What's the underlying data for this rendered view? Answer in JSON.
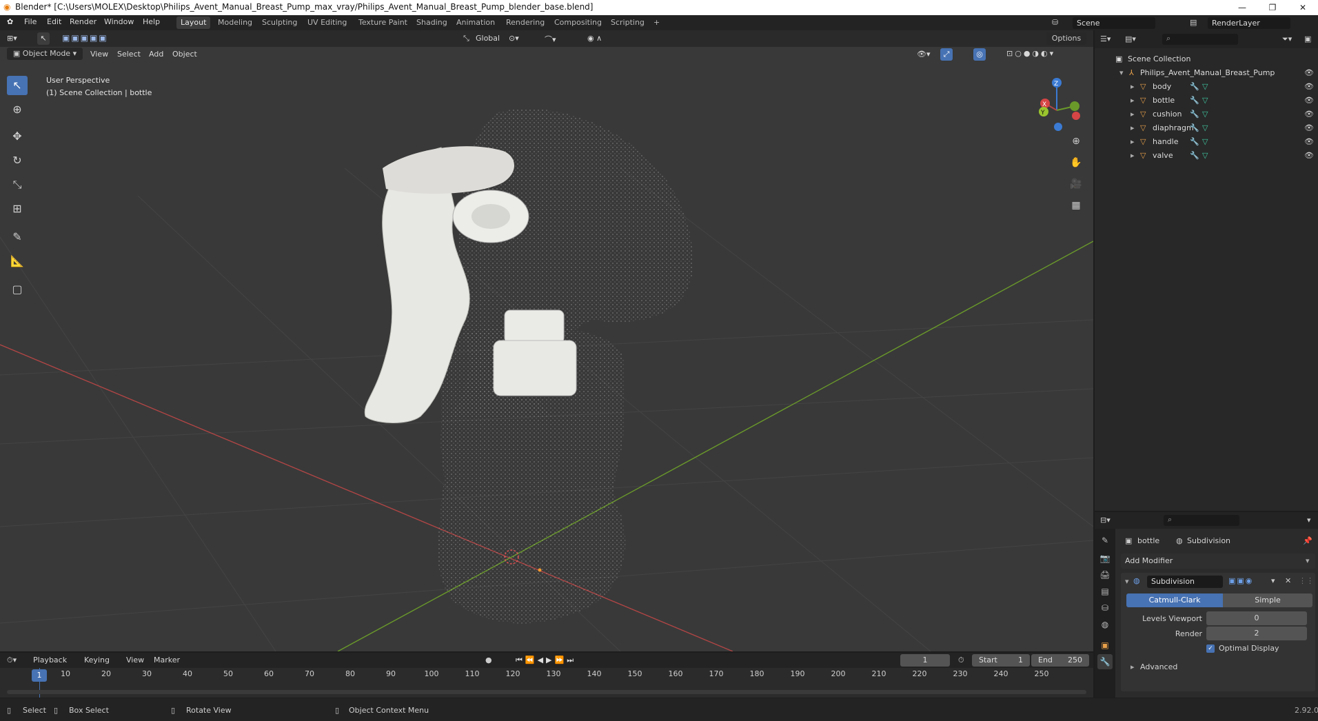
{
  "window": {
    "title": "Blender* [C:\\Users\\MOLEX\\Desktop\\Philips_Avent_Manual_Breast_Pump_max_vray/Philips_Avent_Manual_Breast_Pump_blender_base.blend]",
    "minimize": "—",
    "maximize": "❐",
    "close": "✕"
  },
  "menu": {
    "file": "File",
    "edit": "Edit",
    "render": "Render",
    "window": "Window",
    "help": "Help"
  },
  "workspaces": [
    "Layout",
    "Modeling",
    "Sculpting",
    "UV Editing",
    "Texture Paint",
    "Shading",
    "Animation",
    "Rendering",
    "Compositing",
    "Scripting"
  ],
  "scene": {
    "name": "Scene",
    "render_layer": "RenderLayer"
  },
  "viewport": {
    "mode": "Object Mode",
    "menu": {
      "view": "View",
      "select": "Select",
      "add": "Add",
      "object": "Object"
    },
    "transform_orientation": "Global",
    "options": "Options",
    "overlay_text_1": "User Perspective",
    "overlay_text_2": "(1) Scene Collection | bottle",
    "gizmo": {
      "z": "Z",
      "y": "Y",
      "x": "X"
    }
  },
  "outliner": {
    "root": "Scene Collection",
    "collection": "Philips_Avent_Manual_Breast_Pump",
    "objects": [
      "body",
      "bottle",
      "cushion",
      "diaphragm",
      "handle",
      "valve"
    ]
  },
  "properties": {
    "object": "bottle",
    "modifier": "Subdivision",
    "add_modifier": "Add Modifier",
    "mod_name": "Subdivision",
    "catmull": "Catmull-Clark",
    "simple": "Simple",
    "levels_viewport_label": "Levels Viewport",
    "levels_viewport": "0",
    "render_label": "Render",
    "render_value": "2",
    "optimal_display": "Optimal Display",
    "advanced": "Advanced"
  },
  "timeline": {
    "playback": "Playback",
    "keying": "Keying",
    "view": "View",
    "marker": "Marker",
    "current_frame": "1",
    "start_label": "Start",
    "start": "1",
    "end_label": "End",
    "end": "250",
    "ticks": [
      "1",
      "10",
      "20",
      "30",
      "40",
      "50",
      "60",
      "70",
      "80",
      "90",
      "100",
      "110",
      "120",
      "130",
      "140",
      "150",
      "160",
      "170",
      "180",
      "190",
      "200",
      "210",
      "220",
      "230",
      "240",
      "250"
    ]
  },
  "status": {
    "select": "Select",
    "box_select": "Box Select",
    "rotate_view": "Rotate View",
    "context_menu": "Object Context Menu",
    "version": "2.92.0"
  },
  "colors": {
    "accent": "#4772b3",
    "x_axis": "#b04545",
    "y_axis": "#6a9a2a",
    "z_axis": "#3b7bd4"
  }
}
